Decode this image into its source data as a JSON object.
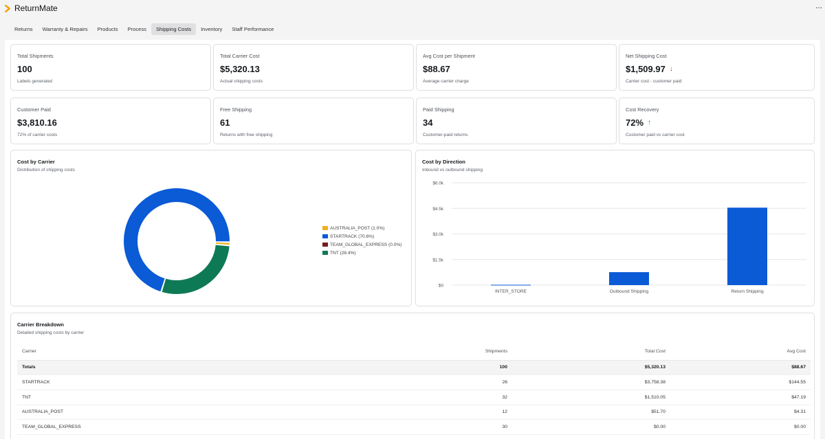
{
  "app": {
    "name": "ReturnMate",
    "more_label": "..."
  },
  "tabs": [
    {
      "label": "Returns",
      "active": false
    },
    {
      "label": "Warranty & Repairs",
      "active": false
    },
    {
      "label": "Products",
      "active": false
    },
    {
      "label": "Process",
      "active": false
    },
    {
      "label": "Shipping Costs",
      "active": true
    },
    {
      "label": "Inventory",
      "active": false
    },
    {
      "label": "Staff Performance",
      "active": false
    }
  ],
  "kpis": [
    {
      "label": "Total Shipments",
      "value": "100",
      "sub": "Labels generated",
      "trend": ""
    },
    {
      "label": "Total Carrier Cost",
      "value": "$5,320.13",
      "sub": "Actual shipping costs",
      "trend": ""
    },
    {
      "label": "Avg Cost per Shipment",
      "value": "$88.67",
      "sub": "Average carrier charge",
      "trend": ""
    },
    {
      "label": "Net Shipping Cost",
      "value": "$1,509.97",
      "sub": "Carrier cost - customer paid",
      "trend": "down"
    },
    {
      "label": "Customer Paid",
      "value": "$3,810.16",
      "sub": "72% of carrier costs",
      "trend": ""
    },
    {
      "label": "Free Shipping",
      "value": "61",
      "sub": "Returns with free shipping",
      "trend": ""
    },
    {
      "label": "Paid Shipping",
      "value": "34",
      "sub": "Customer-paid returns",
      "trend": ""
    },
    {
      "label": "Cost Recovery",
      "value": "72%",
      "sub": "Customer paid vs carrier cost",
      "trend": "up"
    }
  ],
  "carrier_panel": {
    "title": "Cost by Carrier",
    "subtitle": "Distribution of shipping costs"
  },
  "direction_panel": {
    "title": "Cost by Direction",
    "subtitle": "Inbound vs outbound shipping"
  },
  "chart_data": [
    {
      "type": "pie",
      "title": "Cost by Carrier",
      "donut": true,
      "legend_position": "right",
      "slices": [
        {
          "label": "AUSTRALIA_POST (1.0%)",
          "value": 1.0,
          "color": "#f2b01e"
        },
        {
          "label": "STARTRACK (70.6%)",
          "value": 70.6,
          "color": "#0b5ad6"
        },
        {
          "label": "TEAM_GLOBAL_EXPRESS (0.0%)",
          "value": 0.0,
          "color": "#7a1c1c"
        },
        {
          "label": "TNT (28.4%)",
          "value": 28.4,
          "color": "#0e7a55"
        }
      ]
    },
    {
      "type": "bar",
      "title": "Cost by Direction",
      "categories": [
        "INTER_STORE",
        "Outbound Shipping",
        "Return Shipping"
      ],
      "values": [
        20,
        760,
        4540
      ],
      "ylim": [
        0,
        6000
      ],
      "y_ticks": [
        0,
        1500,
        3000,
        4500,
        6000
      ],
      "y_tick_labels": [
        "$0",
        "$1.5k",
        "$3.0k",
        "$4.5k",
        "$6.0k"
      ],
      "grid": true,
      "color": "#0b5ad6"
    }
  ],
  "breakdown": {
    "title": "Carrier Breakdown",
    "subtitle": "Detailed shipping costs by carrier",
    "columns": [
      "Carrier",
      "Shipments",
      "Total Cost",
      "Avg Cost"
    ],
    "rows": [
      {
        "carrier": "Totals",
        "shipments": "100",
        "total": "$5,320.13",
        "avg": "$88.67",
        "is_total": true
      },
      {
        "carrier": "STARTRACK",
        "shipments": "26",
        "total": "$3,758.38",
        "avg": "$144.55",
        "is_total": false
      },
      {
        "carrier": "TNT",
        "shipments": "32",
        "total": "$1,510.05",
        "avg": "$47.19",
        "is_total": false
      },
      {
        "carrier": "AUSTRALIA_POST",
        "shipments": "12",
        "total": "$51.70",
        "avg": "$4.31",
        "is_total": false
      },
      {
        "carrier": "TEAM_GLOBAL_EXPRESS",
        "shipments": "30",
        "total": "$0.00",
        "avg": "$0.00",
        "is_total": false
      }
    ]
  }
}
